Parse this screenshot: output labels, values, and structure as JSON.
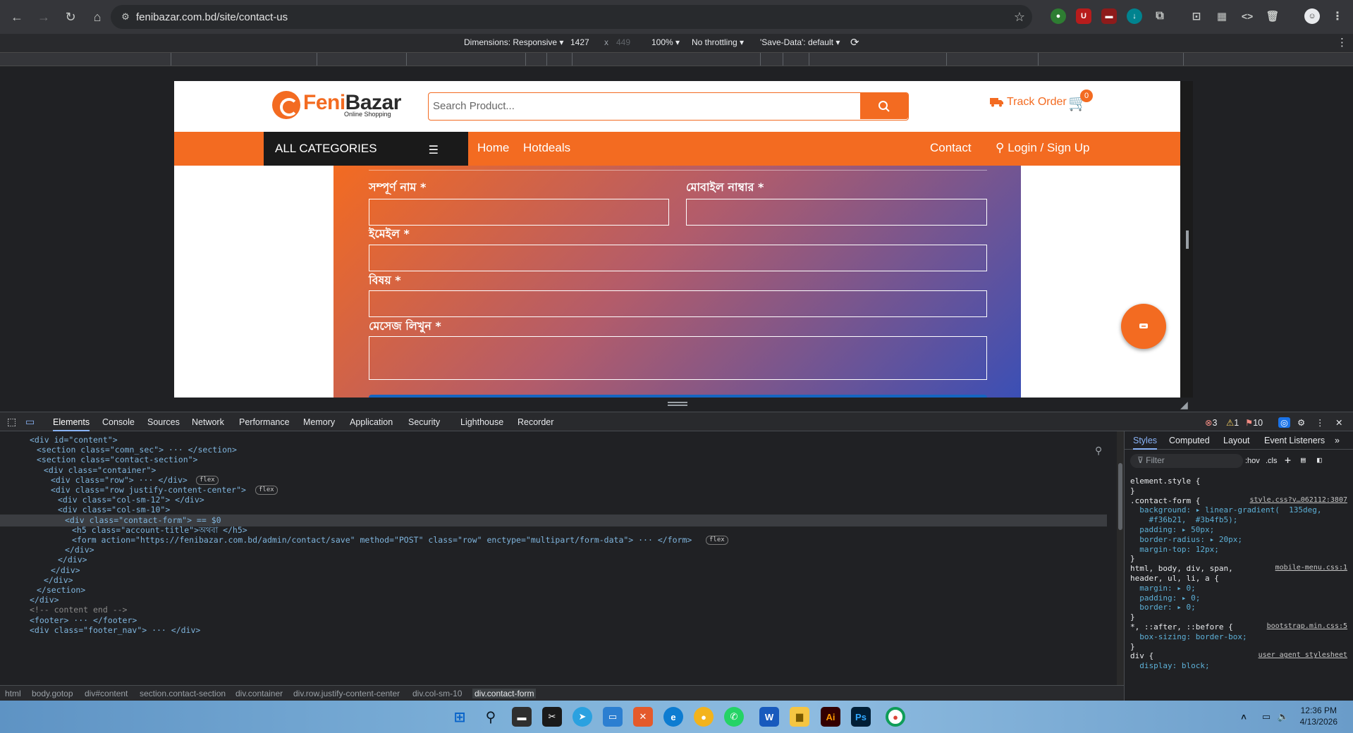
{
  "browser": {
    "url": "fenibazar.com.bd/site/contact-us"
  },
  "device_toolbar": {
    "dimensions_label": "Dimensions: Responsive",
    "width": "1427",
    "x": "x",
    "height": "449",
    "zoom": "100%",
    "throttling": "No throttling",
    "save_data": "'Save-Data': default"
  },
  "site": {
    "logo_brand_feni": "Feni",
    "logo_brand_bazar": "Bazar",
    "logo_tagline": "Online Shopping",
    "search_placeholder": "Search Product...",
    "track_order": "Track Order",
    "cart_count": "0",
    "all_categories": "ALL CATEGORIES",
    "nav": {
      "home": "Home",
      "hotdeals": "Hotdeals",
      "contact": "Contact",
      "login": "Login / Sign Up"
    },
    "form": {
      "full_name": "সম্পূর্ণ নাম *",
      "mobile": "মোবাইল নাম্বার *",
      "email": "ইমেইল *",
      "subject": "বিষয় *",
      "message": "মেসেজ লিখুন *"
    },
    "colors": {
      "brand_orange": "#f36b21",
      "gradient_end": "#3b4fb5"
    }
  },
  "devtools": {
    "tabs": [
      "Elements",
      "Console",
      "Sources",
      "Network",
      "Performance",
      "Memory",
      "Application",
      "Security",
      "Lighthouse",
      "Recorder"
    ],
    "errors": "3",
    "warnings": "1",
    "issues": "10",
    "dom_lines": [
      {
        "indent": 2,
        "text": "<div id=\"content\">"
      },
      {
        "indent": 3,
        "text": "<section class=\"comn_sec\"> ··· </section>"
      },
      {
        "indent": 3,
        "text": "<section class=\"contact-section\">"
      },
      {
        "indent": 4,
        "text": "<div class=\"container\">"
      },
      {
        "indent": 5,
        "text": "<div class=\"row\"> ··· </div>",
        "badge": "flex"
      },
      {
        "indent": 5,
        "text": "<div class=\"row justify-content-center\">",
        "badge": "flex"
      },
      {
        "indent": 6,
        "text": "<div class=\"col-sm-12\"> </div>"
      },
      {
        "indent": 6,
        "text": "<div class=\"col-sm-10\">"
      },
      {
        "indent": 7,
        "text": "<div class=\"contact-form\"> == $0"
      },
      {
        "indent": 8,
        "text": "<h5 class=\"account-title\">অথবা </h5>"
      },
      {
        "indent": 8,
        "text": "<form action=\"https://fenibazar.com.bd/admin/contact/save\" method=\"POST\" class=\"row\" enctype=\"multipart/form-data\"> ··· </form>",
        "badge": "flex"
      },
      {
        "indent": 7,
        "text": "</div>"
      },
      {
        "indent": 6,
        "text": "</div>"
      },
      {
        "indent": 5,
        "text": "</div>"
      },
      {
        "indent": 4,
        "text": "</div>"
      },
      {
        "indent": 3,
        "text": "</section>"
      },
      {
        "indent": 2,
        "text": "</div>"
      },
      {
        "indent": 2,
        "text": "<!-- content end -->"
      },
      {
        "indent": 2,
        "text": "<footer> ··· </footer>"
      },
      {
        "indent": 2,
        "text": "<div class=\"footer_nav\"> ··· </div>"
      }
    ],
    "breadcrumbs": [
      "html",
      "body.gotop",
      "div#content",
      "section.contact-section",
      "div.container",
      "div.row.justify-content-center",
      "div.col-sm-10",
      "div.contact-form"
    ],
    "styles_tabs": [
      "Styles",
      "Computed",
      "Layout",
      "Event Listeners"
    ],
    "filter_placeholder": "Filter",
    "hov": ":hov",
    "cls": ".cls",
    "rules": [
      {
        "sel": "element.style {",
        "src": ""
      },
      {
        "sel": "}",
        "src": ""
      },
      {
        "sel": ".contact-form {",
        "src": "style.css?v…062112:3807"
      },
      {
        "sel": "  background: ▸ linear-gradient(  135deg,",
        "src": ""
      },
      {
        "sel": "    #f36b21,  #3b4fb5);",
        "src": ""
      },
      {
        "sel": "  padding: ▸ 50px;",
        "src": ""
      },
      {
        "sel": "  border-radius: ▸ 20px;",
        "src": ""
      },
      {
        "sel": "  margin-top: 12px;",
        "src": ""
      },
      {
        "sel": "}",
        "src": ""
      },
      {
        "sel": "html, body, div, span,",
        "src": "mobile-menu.css:1"
      },
      {
        "sel": "header, ul, li, a {",
        "src": ""
      },
      {
        "sel": "  margin: ▸ 0;",
        "src": ""
      },
      {
        "sel": "  padding: ▸ 0;",
        "src": ""
      },
      {
        "sel": "  border: ▸ 0;",
        "src": ""
      },
      {
        "sel": "}",
        "src": ""
      },
      {
        "sel": "*, ::after, ::before {",
        "src": "bootstrap.min.css:5"
      },
      {
        "sel": "  box-sizing: border-box;",
        "src": ""
      },
      {
        "sel": "}",
        "src": ""
      },
      {
        "sel": "div {",
        "src": "user agent stylesheet"
      },
      {
        "sel": "  display: block;",
        "src": ""
      }
    ]
  },
  "taskbar": {
    "time": "12:36 PM",
    "date": "4/13/2026"
  }
}
